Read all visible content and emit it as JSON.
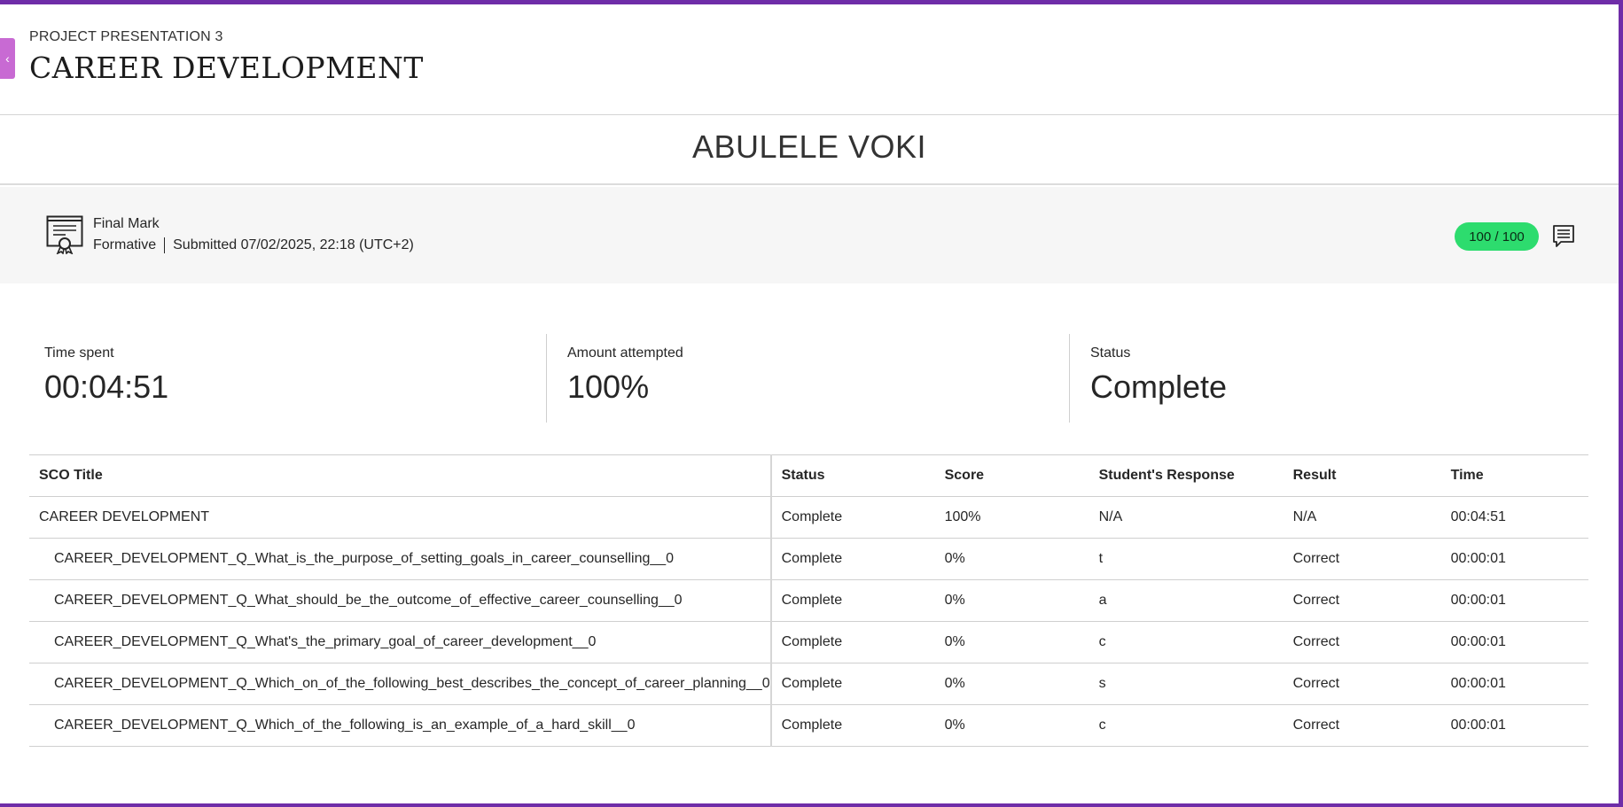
{
  "header": {
    "subtitle": "PROJECT PRESENTATION 3",
    "title": "CAREER DEVELOPMENT",
    "back_glyph": "‹"
  },
  "student": {
    "name": "ABULELE VOKI"
  },
  "final_mark": {
    "label": "Final Mark",
    "type": "Formative",
    "submitted": "Submitted 07/02/2025, 22:18 (UTC+2)",
    "score": "100 / 100",
    "score_color": "#2ddc6e"
  },
  "stats": {
    "time_spent_label": "Time spent",
    "time_spent_value": "00:04:51",
    "attempted_label": "Amount attempted",
    "attempted_value": "100%",
    "status_label": "Status",
    "status_value": "Complete"
  },
  "table": {
    "headers": [
      "SCO Title",
      "Status",
      "Score",
      "Student's Response",
      "Result",
      "Time"
    ],
    "rows": [
      [
        "CAREER DEVELOPMENT",
        "Complete",
        "100%",
        "N/A",
        "N/A",
        "00:04:51"
      ],
      [
        "CAREER_DEVELOPMENT_Q_What_is_the_purpose_of_setting_goals_in_career_counselling__0",
        "Complete",
        "0%",
        "t",
        "Correct",
        "00:00:01"
      ],
      [
        "CAREER_DEVELOPMENT_Q_What_should_be_the_outcome_of_effective_career_counselling__0",
        "Complete",
        "0%",
        "a",
        "Correct",
        "00:00:01"
      ],
      [
        "CAREER_DEVELOPMENT_Q_What's_the_primary_goal_of_career_development__0",
        "Complete",
        "0%",
        "c",
        "Correct",
        "00:00:01"
      ],
      [
        "CAREER_DEVELOPMENT_Q_Which_on_of_the_following_best_describes_the_concept_of_career_planning__0",
        "Complete",
        "0%",
        "s",
        "Correct",
        "00:00:01"
      ],
      [
        "CAREER_DEVELOPMENT_Q_Which_of_the_following_is_an_example_of_a_hard_skill__0",
        "Complete",
        "0%",
        "c",
        "Correct",
        "00:00:01"
      ]
    ]
  },
  "colors": {
    "frame": "#6f2da8",
    "back_tab": "#c86ad3",
    "band": "#f6f6f6"
  }
}
